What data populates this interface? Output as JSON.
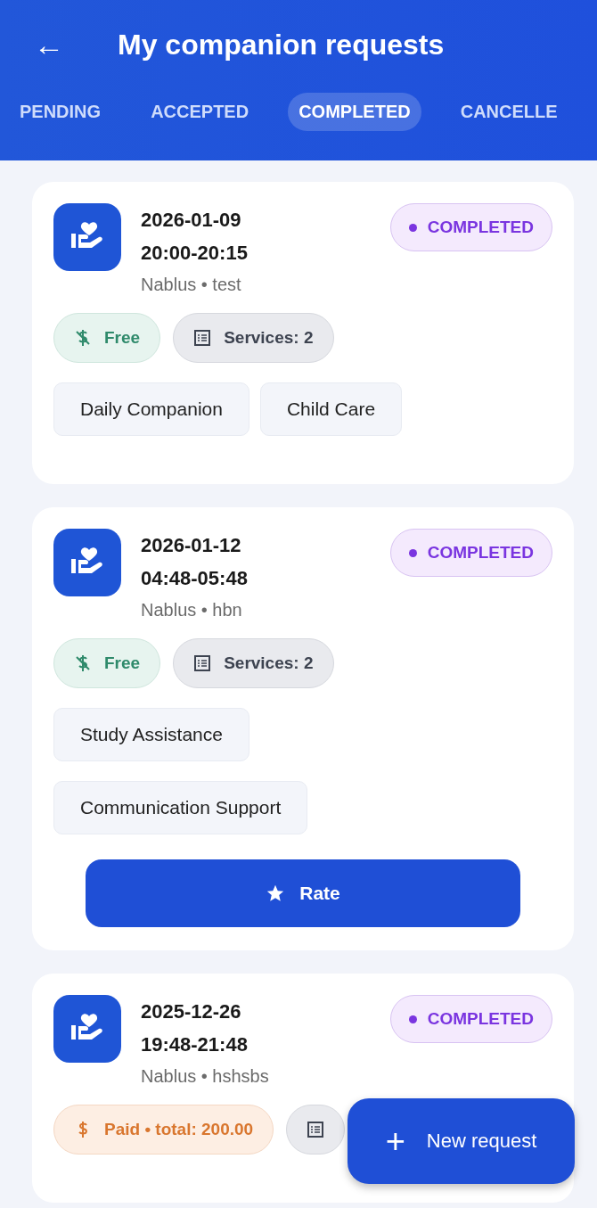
{
  "app_bar": {
    "back_icon": "←",
    "title": "My companion requests"
  },
  "tabs": [
    {
      "label": "PENDING",
      "selected": false
    },
    {
      "label": "ACCEPTED",
      "selected": false
    },
    {
      "label": "COMPLETED",
      "selected": true
    },
    {
      "label": "CANCELLE",
      "selected": false
    }
  ],
  "requests": [
    {
      "date": "2026-01-09",
      "time": "20:00-20:15",
      "location": "Nablus • test",
      "status": "COMPLETED",
      "chips": [
        {
          "kind": "free",
          "label": "Free"
        },
        {
          "kind": "services",
          "label": "Services: 2"
        }
      ],
      "services": [
        "Daily Companion",
        "Child Care"
      ]
    },
    {
      "date": "2026-01-12",
      "time": "04:48-05:48",
      "location": "Nablus • hbn",
      "status": "COMPLETED",
      "chips": [
        {
          "kind": "free",
          "label": "Free"
        },
        {
          "kind": "services",
          "label": "Services: 2"
        }
      ],
      "services": [
        "Study Assistance",
        "Communication Support"
      ],
      "action": {
        "label": "Rate"
      }
    },
    {
      "date": "2025-12-26",
      "time": "19:48-21:48",
      "location": "Nablus • hshsbs",
      "status": "COMPLETED",
      "chips": [
        {
          "kind": "paid",
          "label": "Paid • total: 200.00"
        },
        {
          "kind": "services"
        }
      ]
    }
  ],
  "fab": {
    "icon": "+",
    "label": "New request"
  }
}
